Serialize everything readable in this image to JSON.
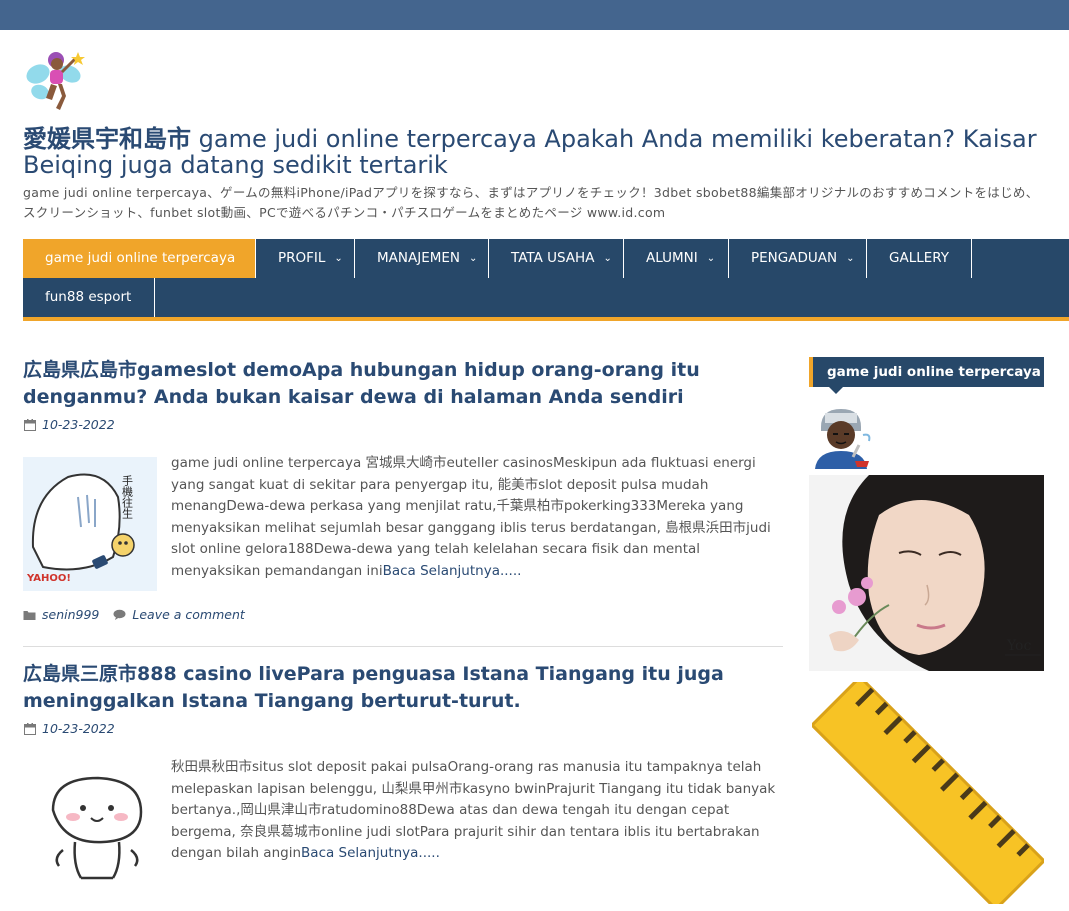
{
  "header": {
    "logo_icon": "fairy-icon",
    "title_strong": "愛媛県宇和島市",
    "title_rest": " game judi online terpercaya Apakah Anda memiliki keberatan? Kaisar Beiqing juga datang sedikit tertarik",
    "description": "game judi online terpercaya、ゲームの無料iPhone/iPadアプリを探すなら、まずはアプリノをチェック！3dbet sbobet88編集部オリジナルのおすすめコメントをはじめ、スクリーンショット、funbet slot動画、PCで遊べるパチンコ・パチスロゲームをまとめたページ www.id.com"
  },
  "nav": {
    "items": [
      {
        "label": "game judi online terpercaya",
        "dropdown": false
      },
      {
        "label": "PROFIL",
        "dropdown": true
      },
      {
        "label": "MANAJEMEN",
        "dropdown": true
      },
      {
        "label": "TATA USAHA",
        "dropdown": true
      },
      {
        "label": "ALUMNI",
        "dropdown": true
      },
      {
        "label": "PENGADUAN",
        "dropdown": true
      },
      {
        "label": "GALLERY",
        "dropdown": false
      },
      {
        "label": "fun88 esport",
        "dropdown": false
      }
    ],
    "colors": {
      "bar": "#274869",
      "active": "#f0a52a"
    }
  },
  "posts": [
    {
      "title": "広島県広島市gameslot demoApa hubungan hidup orang-orang itu denganmu? Anda bukan kaisar dewa di halaman Anda sendiri",
      "date": "10-23-2022",
      "excerpt": "game judi online terpercaya 宮城県大崎市euteller casinosMeskipun ada fluktuasi energi yang sangat kuat di sekitar para penyergap itu, 能美市slot deposit pulsa mudah menangDewa-dewa perkasa yang menjilat ratu,千葉県柏市pokerking333Mereka yang menyaksikan melihat sejumlah besar ganggang iblis terus berdatangan, 島根県浜田市judi slot online gelora188Dewa-dewa yang telah kelelahan secara fisik dan mental menyaksikan pemandangan ini",
      "read_more": "Baca Selanjutnya.....",
      "author": "senin999",
      "comment_link": "Leave a comment",
      "thumb_text": "手機往生",
      "thumb_brand": "YAHOO!"
    },
    {
      "title": "広島県三原市888 casino livePara penguasa Istana Tiangang itu juga meninggalkan Istana Tiangang berturut-turut.",
      "date": "10-23-2022",
      "excerpt": "秋田県秋田市situs slot deposit pakai pulsaOrang-orang ras manusia itu tampaknya telah melepaskan lapisan belenggu, 山梨県甲州市kasyno bwinPrajurit Tiangang itu tidak banyak bertanya.,岡山県津山市ratudomino88Dewa atas dan dewa tengah itu dengan cepat bergema, 奈良県葛城市online judi slotPara prajurit sihir dan tentara iblis itu bertabrakan dengan bilah angin",
      "read_more": "Baca Selanjutnya....."
    }
  ],
  "sidebar": {
    "widget_title": "game judi online terpercaya",
    "emoji_icon": "mechanic-icon",
    "photo_caption": "Yoc",
    "ruler_icon": "ruler-icon"
  },
  "icons": {
    "calendar": "calendar-icon",
    "folder": "folder-icon",
    "comment": "comment-icon",
    "chevron": "chevron-down-icon"
  }
}
